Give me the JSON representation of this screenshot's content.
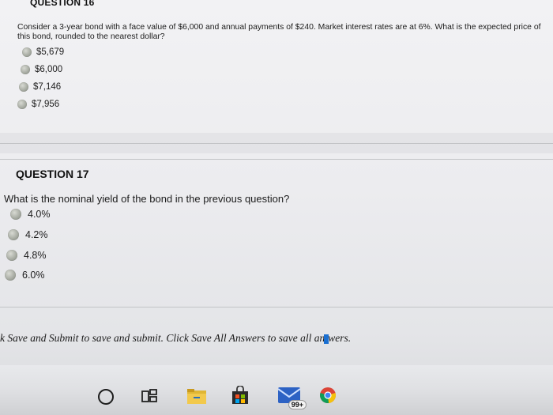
{
  "question16": {
    "heading": "QUESTION 16",
    "text": "Consider a 3-year bond with a face value of $6,000 and annual payments of $240. Market interest rates are at 6%. What is the expected price of this bond, rounded to the nearest dollar?",
    "choices": [
      "$5,679",
      "$6,000",
      "$7,146",
      "$7,956"
    ]
  },
  "question17": {
    "heading": "QUESTION 17",
    "text": "What is the nominal yield of the bond in the previous question?",
    "choices": [
      "4.0%",
      "4.2%",
      "4.8%",
      "6.0%"
    ]
  },
  "footer": {
    "text_before": "k Save and Submit to save and submit. Click Save All Answers to save all an",
    "text_after": "wers."
  },
  "taskbar": {
    "mail_badge": "99+",
    "icons": [
      "cortana-ring-icon",
      "task-view-icon",
      "file-explorer-icon",
      "store-icon",
      "mail-icon",
      "chrome-icon"
    ]
  }
}
